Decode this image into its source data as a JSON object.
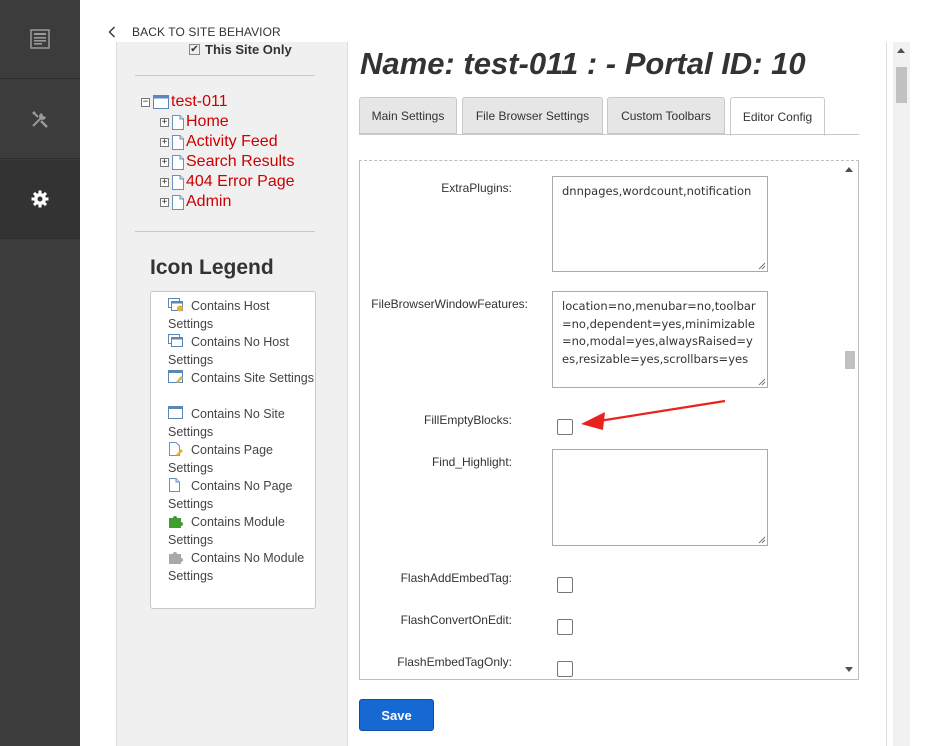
{
  "back_link": {
    "label": "BACK TO SITE BEHAVIOR"
  },
  "left_panel": {
    "site_only_label": "This Site Only",
    "site_only_checked": true,
    "tree": {
      "root": "test-011",
      "children": [
        "Home",
        "Activity Feed",
        "Search Results",
        "404 Error Page",
        "Admin"
      ]
    },
    "legend_title": "Icon Legend",
    "legend": [
      {
        "icon": "host-settings-icon",
        "label": "Contains Host Settings"
      },
      {
        "icon": "no-host-settings-icon",
        "label": "Contains No Host Settings"
      },
      {
        "icon": "site-settings-icon",
        "label": "Contains Site Settings"
      },
      {
        "icon": "no-site-settings-icon",
        "label": "Contains No Site Settings"
      },
      {
        "icon": "page-settings-icon",
        "label": "Contains Page Settings"
      },
      {
        "icon": "no-page-settings-icon",
        "label": "Contains No Page Settings"
      },
      {
        "icon": "module-settings-icon",
        "label": "Contains Module Settings"
      },
      {
        "icon": "no-module-settings-icon",
        "label": "Contains No Module Settings"
      }
    ]
  },
  "main": {
    "title": "Name: test-011 : - Portal ID: 10",
    "tabs": [
      {
        "label": "Main Settings",
        "active": false
      },
      {
        "label": "File Browser Settings",
        "active": false
      },
      {
        "label": "Custom Toolbars",
        "active": false
      },
      {
        "label": "Editor Config",
        "active": true
      }
    ],
    "fields": {
      "extra_plugins": {
        "label": "ExtraPlugins:",
        "value": "dnnpages,wordcount,notification"
      },
      "file_browser_window_features": {
        "label": "FileBrowserWindowFeatures:",
        "value": "location=no,menubar=no,toolbar=no,dependent=yes,minimizable=no,modal=yes,alwaysRaised=yes,resizable=yes,scrollbars=yes"
      },
      "fill_empty_blocks": {
        "label": "FillEmptyBlocks:",
        "checked": false
      },
      "find_highlight": {
        "label": "Find_Highlight:",
        "value": ""
      },
      "flash_add_embed_tag": {
        "label": "FlashAddEmbedTag:",
        "checked": false
      },
      "flash_convert_on_edit": {
        "label": "FlashConvertOnEdit:",
        "checked": false
      },
      "flash_embed_tag_only": {
        "label": "FlashEmbedTagOnly:",
        "checked": false
      }
    },
    "save_label": "Save"
  },
  "sidebar_icons": [
    "document-list-icon",
    "tools-icon",
    "gear-icon"
  ],
  "colors": {
    "rail": "#3c3c3c",
    "tree_link": "#cc0000",
    "save_button": "#1668d3",
    "annotation_arrow": "#e8231d"
  }
}
